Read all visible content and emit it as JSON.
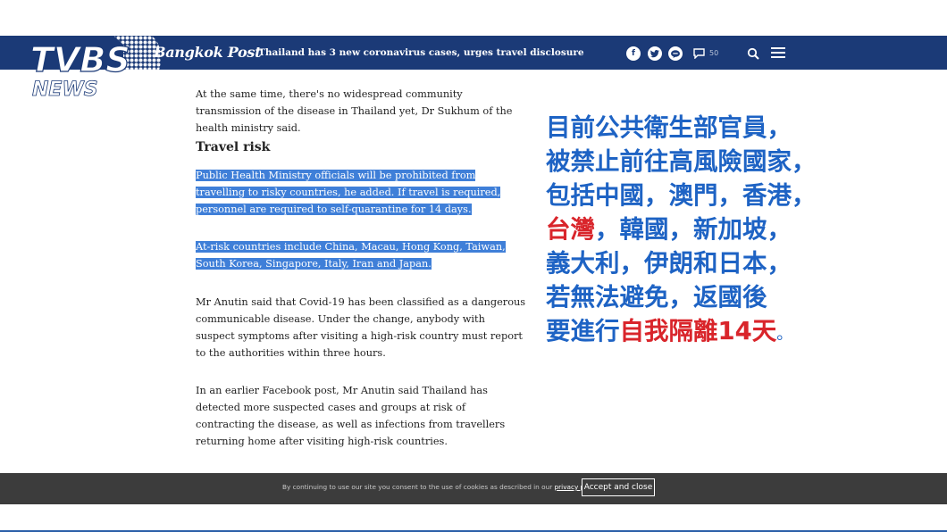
{
  "site": {
    "name": "Bangkok Post",
    "headline": "Thailand has 3 new coronavirus cases, urges travel disclosure",
    "comment_count": "50"
  },
  "watermark": {
    "line1": "TVBS",
    "line2": "NEWS"
  },
  "article": {
    "p1": "At the same time, there's no widespread community transmission of the disease in Thailand yet, Dr Sukhum of the health ministry said.",
    "heading": "Travel risk",
    "p2": "Public Health Ministry officials will be prohibited from travelling to risky countries, he added. If travel is required, personnel are required to self-quarantine for 14 days.",
    "p3": "At-risk countries include China, Macau, Hong Kong, Taiwan, South Korea, Singapore, Italy, Iran and Japan.",
    "p4": "Mr Anutin said that Covid-19 has been classified as a dangerous communicable disease. Under the change, anybody with suspect symptoms after visiting a high-risk country must report to the authorities within three hours.",
    "p5": "In an earlier Facebook post, Mr Anutin said Thailand has detected more suspected cases and groups at risk of contracting the disease, as well as infections from travellers returning home after visiting high-risk countries."
  },
  "overlay": {
    "l1": "目前公共衛生部官員，",
    "l2": "被禁止前往高風險國家，",
    "l3": "包括中國，澳門，香港，",
    "l4_red": "台灣",
    "l4_rest": "，韓國，新加坡，",
    "l5": "義大利，伊朗和日本，",
    "l6": "若無法避免，返國後",
    "l7_a": "要進行",
    "l7_red": "自我隔離14天",
    "l7_end": "。",
    "accent_blue": "#1e63c4",
    "accent_red": "#d9252b"
  },
  "cookie": {
    "text": "By continuing to use our site you consent to the use of cookies as described in our ",
    "link": "privacy policy",
    "button": "Accept and close"
  },
  "colors": {
    "navbar": "#1b3a77",
    "highlight": "#3f7fd8"
  }
}
